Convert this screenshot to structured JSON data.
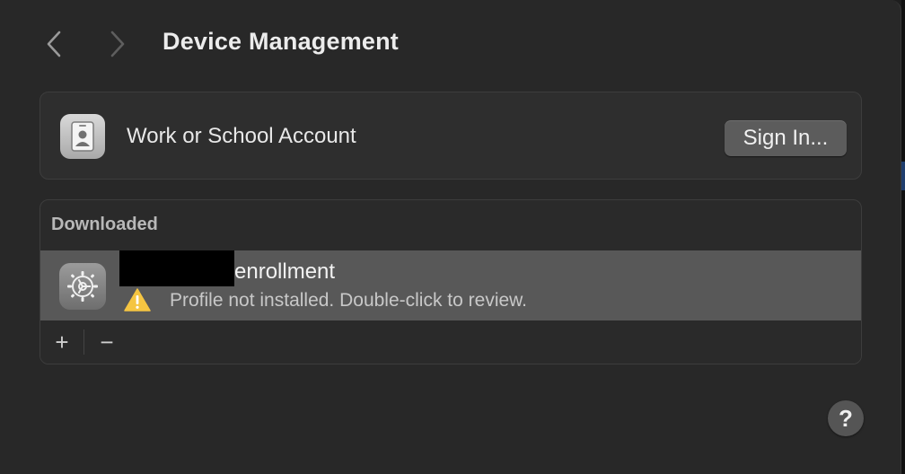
{
  "toolbar": {
    "back_icon": "chevron-left-icon",
    "forward_icon": "chevron-right-icon",
    "title": "Device Management"
  },
  "account": {
    "icon": "id-badge-icon",
    "label": "Work or School Account",
    "sign_in_label": "Sign In..."
  },
  "downloaded": {
    "header": "Downloaded",
    "profiles": [
      {
        "icon": "gear-icon",
        "name_suffix": "enrollment",
        "status_icon": "warning-icon",
        "status": "Profile not installed. Double-click to review."
      }
    ],
    "footer": {
      "add_label": "+",
      "remove_label": "−"
    }
  },
  "help": {
    "label": "?"
  },
  "colors": {
    "window_bg": "#282828",
    "card_bg": "#2e2e2e",
    "selected_row": "#585858",
    "button_bg": "#5c5c5c",
    "warning": "#f5c542"
  }
}
